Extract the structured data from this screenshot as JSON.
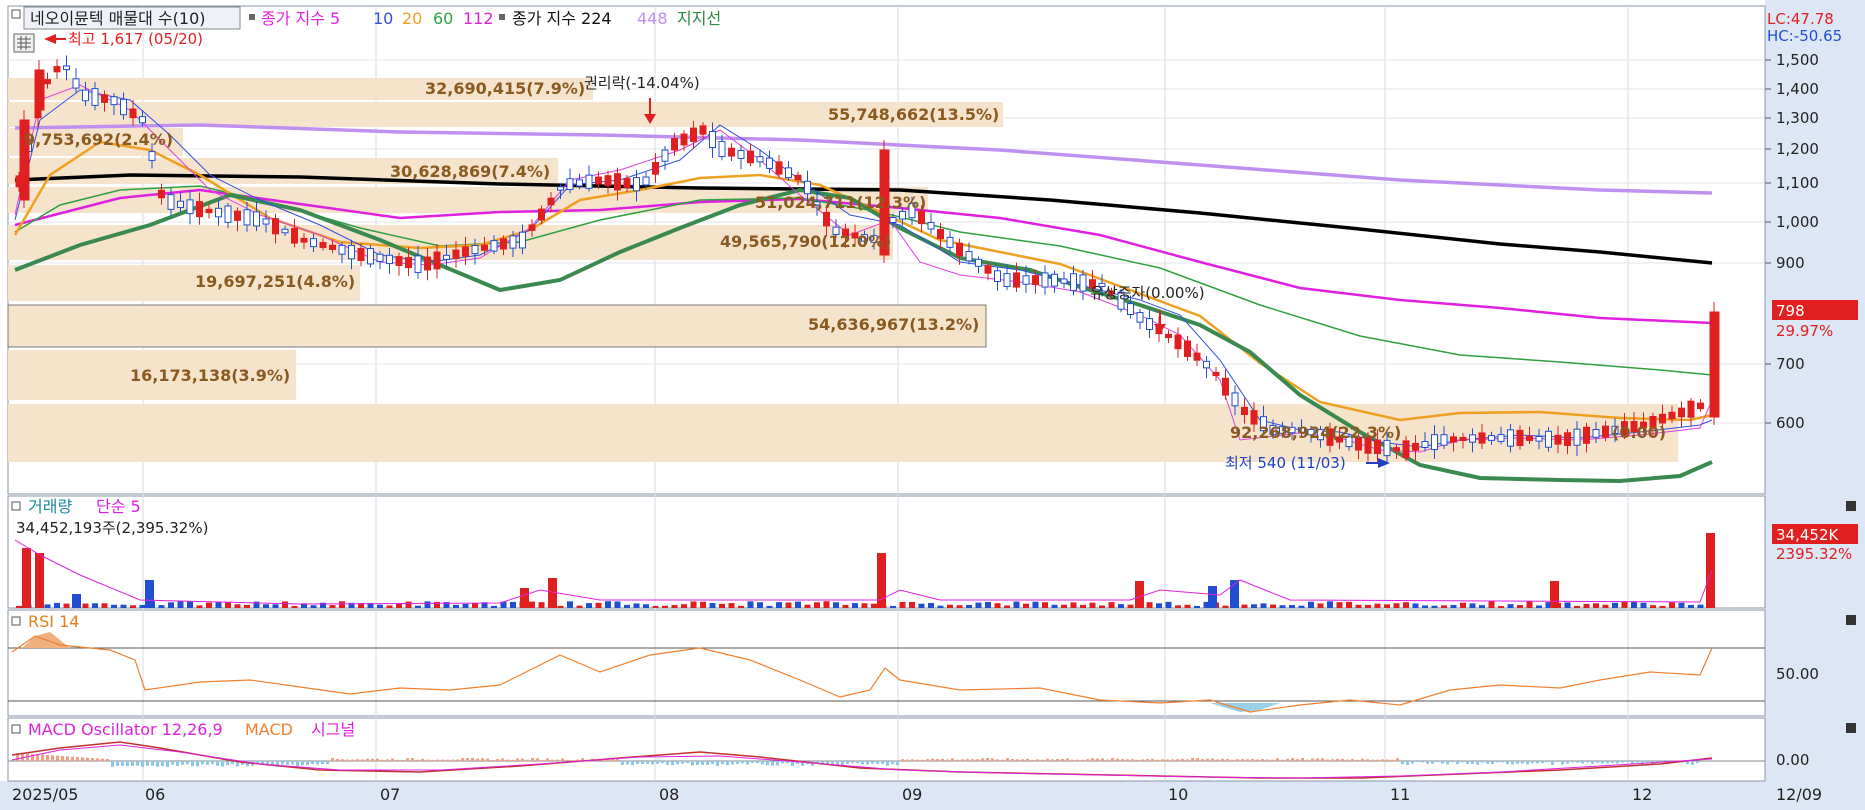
{
  "header": {
    "title": "네오이뮨텍 매물대 수(10)",
    "ma_label": "종가 지수 5",
    "ma_periods": [
      "10",
      "20",
      "60",
      "112"
    ],
    "ma2_label": "종가 지수 224",
    "ma2_extra": "448",
    "support_label": "지지선"
  },
  "price_axis": {
    "ticks": [
      "1,500",
      "1,400",
      "1,300",
      "1,200",
      "1,100",
      "1,000",
      "900",
      "700",
      "600"
    ],
    "lc_label": "LC:47.78",
    "hc_label": "HC:-50.65",
    "current_price": "798",
    "current_change": "29.97%"
  },
  "annotations": {
    "high": "최고 1,617 (05/20)",
    "low": "최저 540 (11/03)",
    "rights": "권리락(-14.04%)",
    "capital": "유상증자(0.00%)"
  },
  "volume_profile": [
    {
      "label": "32,690,415(7.9%)"
    },
    {
      "label": "55,748,662(13.5%)"
    },
    {
      "label": "9,753,692(2.4%)"
    },
    {
      "label": "30,628,869(7.4%)"
    },
    {
      "label": "51,024,711(12.3%)"
    },
    {
      "label": "49,565,790(12.0%)"
    },
    {
      "label": "19,697,251(4.8%)"
    },
    {
      "label": "54,636,967(13.2%)"
    },
    {
      "label": "16,173,138(3.9%)"
    },
    {
      "label": "92,268,924(22.3%)"
    },
    {
      "label": "(0.00)"
    }
  ],
  "volume_panel": {
    "title": "거래량",
    "ma_label": "단순 5",
    "info": "34,452,193주(2,395.32%)",
    "current": "34,452K",
    "current_pct": "2395.32%"
  },
  "rsi_panel": {
    "title": "RSI 14",
    "tick": "50.00"
  },
  "macd_panel": {
    "title": "MACD Oscillator 12,26,9",
    "macd_label": "MACD",
    "signal_label": "시그널",
    "tick": "0.00"
  },
  "x_axis": {
    "labels": [
      "2025/05",
      "06",
      "07",
      "08",
      "09",
      "10",
      "11",
      "12",
      "12/09"
    ]
  },
  "colors": {
    "up": "#e02020",
    "down": "#2050d0",
    "ma5": "#e040e0",
    "ma10": "#3050e0",
    "ma20": "#f0a020",
    "ma60": "#30a040",
    "ma112": "#e020e0",
    "ma224": "#000000",
    "ma448": "#c090f0",
    "support": "#3a8a50",
    "profile": "#f5e3cc",
    "rsi": "#f08030"
  },
  "chart_data": [
    {
      "type": "candlestick",
      "title": "네오이뮨텍 매물대 수(10)",
      "x_range": [
        "2025/05",
        "12/09"
      ],
      "ylim": [
        540,
        1617
      ],
      "ohlc_approx": [
        {
          "period": "05",
          "close": 1300
        },
        {
          "period": "06",
          "close": 960
        },
        {
          "period": "07",
          "close": 920
        },
        {
          "period": "08",
          "close": 1200
        },
        {
          "period": "09",
          "close": 850
        },
        {
          "period": "10",
          "close": 600
        },
        {
          "period": "11",
          "close": 580
        },
        {
          "period": "12",
          "close": 798
        }
      ],
      "high": 1617,
      "low": 540,
      "last": 798
    },
    {
      "type": "bar",
      "title": "거래량",
      "last": 34452193
    },
    {
      "type": "line",
      "title": "RSI 14",
      "ylim": [
        0,
        100
      ]
    },
    {
      "type": "bar",
      "title": "MACD Oscillator 12,26,9"
    }
  ]
}
